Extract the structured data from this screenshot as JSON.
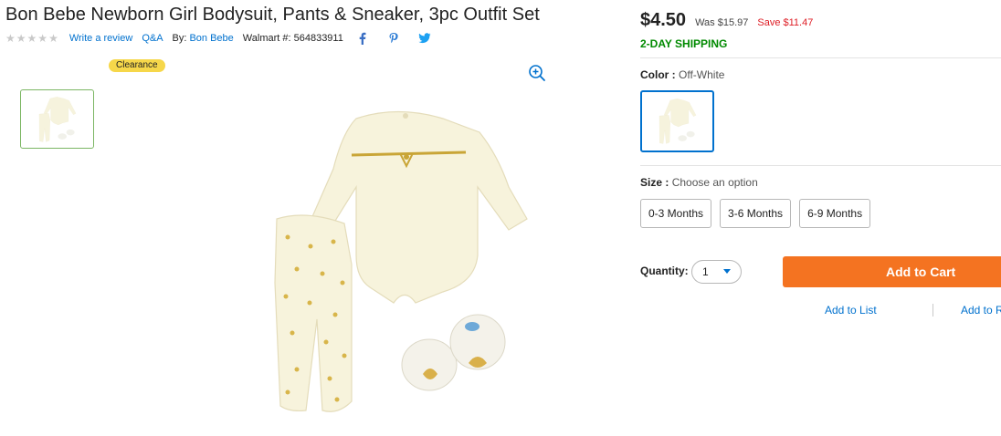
{
  "product": {
    "title": "Bon Bebe Newborn Girl Bodysuit, Pants & Sneaker, 3pc Outfit Set",
    "write_review": "Write a review",
    "qa": "Q&A",
    "by_label": "By:",
    "brand": "Bon Bebe",
    "walmart_number": "Walmart #: 564833911",
    "rating_stars": 5,
    "badge": "Clearance"
  },
  "pricing": {
    "current": "$4.50",
    "was": "Was $15.97",
    "save": "Save $11.47",
    "shipping": "2-DAY SHIPPING"
  },
  "options": {
    "color_label": "Color :",
    "color_value": "Off-White",
    "size_label": "Size :",
    "size_value": "Choose an option",
    "sizes": [
      "0-3 Months",
      "3-6 Months",
      "6-9 Months"
    ]
  },
  "purchase": {
    "quantity_label": "Quantity:",
    "quantity_value": "1",
    "add_to_cart": "Add to Cart",
    "add_to_list": "Add to List",
    "add_to_registry": "Add to Registry"
  },
  "colors": {
    "accent": "#0071ce",
    "cart": "#f47321",
    "shipping": "#008a00",
    "save": "#de1c24",
    "badge": "#f6d74a"
  }
}
